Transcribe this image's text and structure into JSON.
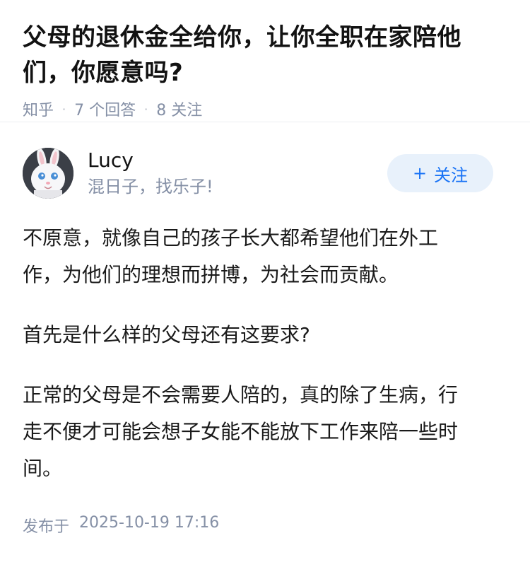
{
  "question": {
    "title_line1": "父母的退休金全给你，让你全职在家陪他",
    "title_line2": "们，你愿意吗?",
    "source": "知乎",
    "answers_count": "7",
    "answers_label": "个回答",
    "follows_count": "8",
    "follows_label": "关注"
  },
  "answer": {
    "author_name": "Lucy",
    "author_bio": "混日子，找乐子!",
    "follow_plus": "+",
    "follow_label": "关注",
    "paragraphs": [
      [
        "不原意，就像自己的孩子长大都希望他们在外工",
        "作，为他们的理想而拼博，为社会而贡献。"
      ],
      [
        "首先是什么样的父母还有这要求?"
      ],
      [
        "正常的父母是不会需要人陪的，真的除了生病，行",
        "走不便才可能会想子女能不能放下工作来陪一些时",
        "间。"
      ]
    ],
    "published_label": "发布于",
    "published_time": "2025-10-19 17:16"
  },
  "colors": {
    "accent": "#1772f6",
    "follow_bg": "#e8f1fb",
    "meta": "#8590a6",
    "divider": "#eceef2"
  }
}
